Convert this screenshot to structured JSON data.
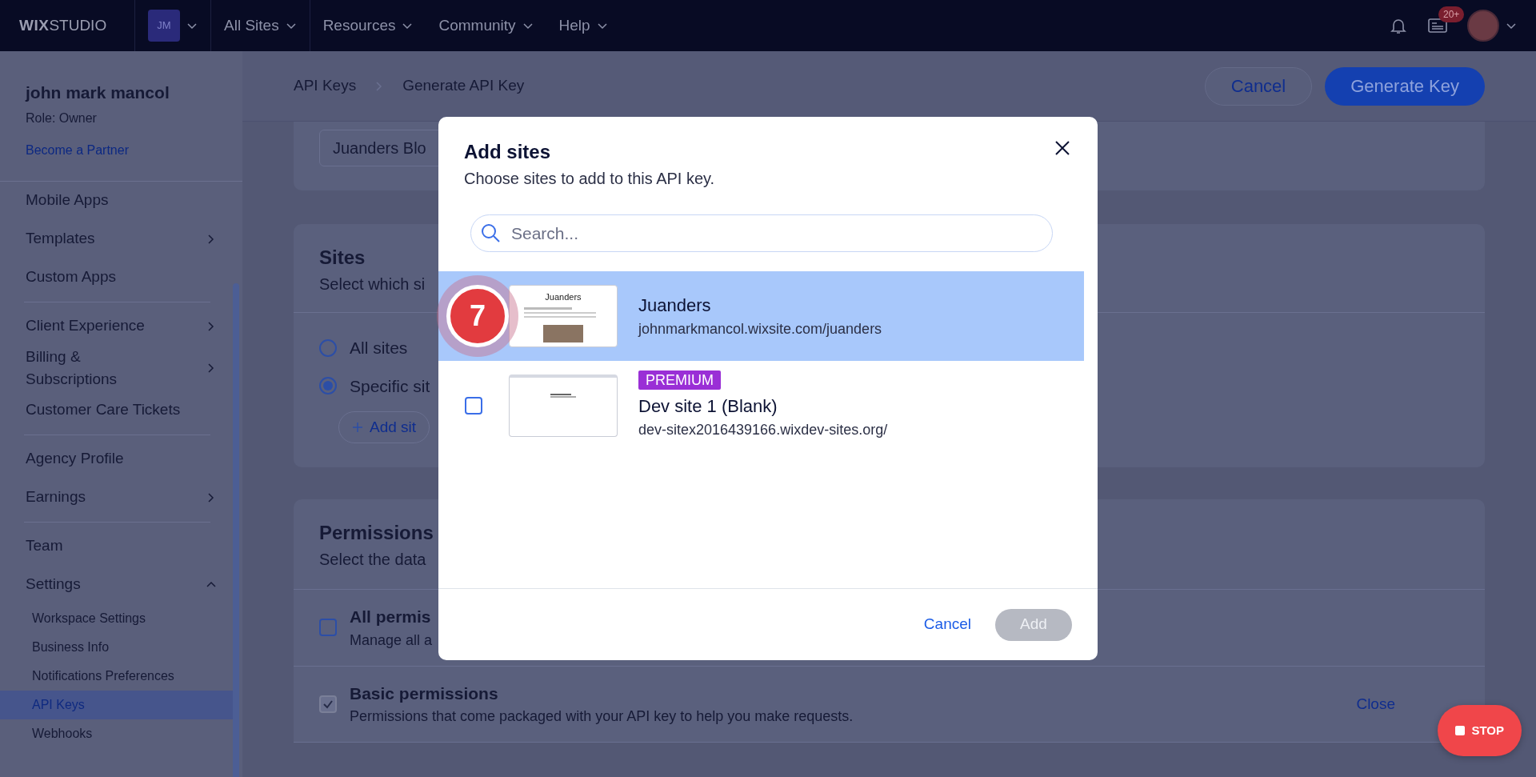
{
  "topbar": {
    "logo_bold": "WIX",
    "logo_light": "STUDIO",
    "workspace_initials": "JM",
    "nav": [
      {
        "label": "All Sites"
      },
      {
        "label": "Resources"
      },
      {
        "label": "Community"
      },
      {
        "label": "Help"
      }
    ],
    "notifications_badge": "20+"
  },
  "sidebar": {
    "user_name": "john mark mancol",
    "role": "Role: Owner",
    "partner_link": "Become a Partner",
    "groups": [
      [
        {
          "label": "Mobile Apps",
          "kind": "plain",
          "selected": false
        },
        {
          "label": "Templates",
          "kind": "submenu",
          "selected": false
        },
        {
          "label": "Custom Apps",
          "kind": "plain",
          "selected": false
        }
      ],
      [
        {
          "label": "Client Experience",
          "kind": "submenu",
          "selected": false
        },
        {
          "label": "Billing & Subscriptions",
          "kind": "submenu",
          "selected": false
        },
        {
          "label": "Customer Care Tickets",
          "kind": "plain",
          "selected": false
        }
      ],
      [
        {
          "label": "Agency Profile",
          "kind": "plain",
          "selected": false
        },
        {
          "label": "Earnings",
          "kind": "submenu",
          "selected": false
        }
      ],
      [
        {
          "label": "Team",
          "kind": "plain",
          "selected": false
        },
        {
          "label": "Settings",
          "kind": "expanded",
          "selected": false,
          "children": [
            {
              "label": "Workspace Settings",
              "selected": false
            },
            {
              "label": "Business Info",
              "selected": false
            },
            {
              "label": "Notifications Preferences",
              "selected": false
            },
            {
              "label": "API Keys",
              "selected": true
            },
            {
              "label": "Webhooks",
              "selected": false
            }
          ]
        }
      ]
    ]
  },
  "header": {
    "breadcrumb": [
      "API Keys",
      "Generate API Key"
    ],
    "cancel_label": "Cancel",
    "generate_label": "Generate Key"
  },
  "key_name_card": {
    "value": "Juanders Blo"
  },
  "sites_card": {
    "title": "Sites",
    "subtitle": "Select which si",
    "options": [
      {
        "label": "All sites",
        "selected": false
      },
      {
        "label": "Specific sit",
        "selected": true
      }
    ],
    "add_button": "Add sit"
  },
  "permissions_card": {
    "title": "Permissions",
    "subtitle": "Select the data",
    "rows": [
      {
        "title": "All permis",
        "description": "Manage all a",
        "checked": false,
        "disabled": false
      },
      {
        "title": "Basic permissions",
        "description": "Permissions that come packaged with your API key to help you make requests.",
        "checked": true,
        "disabled": true,
        "action": "Close"
      }
    ]
  },
  "modal": {
    "title": "Add sites",
    "subtitle": "Choose sites to add to this API key.",
    "search": {
      "placeholder": "Search..."
    },
    "sites": [
      {
        "name": "Juanders",
        "url": "johnmarkmancol.wixsite.com/juanders",
        "selected": true,
        "thumbnail_title": "Juanders",
        "step_badge": "7"
      },
      {
        "badge": "PREMIUM",
        "name": "Dev site 1 (Blank)",
        "url": "dev-sitex2016439166.wixdev-sites.org/",
        "selected": false,
        "checked": false
      }
    ],
    "cancel_label": "Cancel",
    "add_label": "Add",
    "add_disabled": true
  },
  "recorder": {
    "stop_label": "STOP"
  }
}
